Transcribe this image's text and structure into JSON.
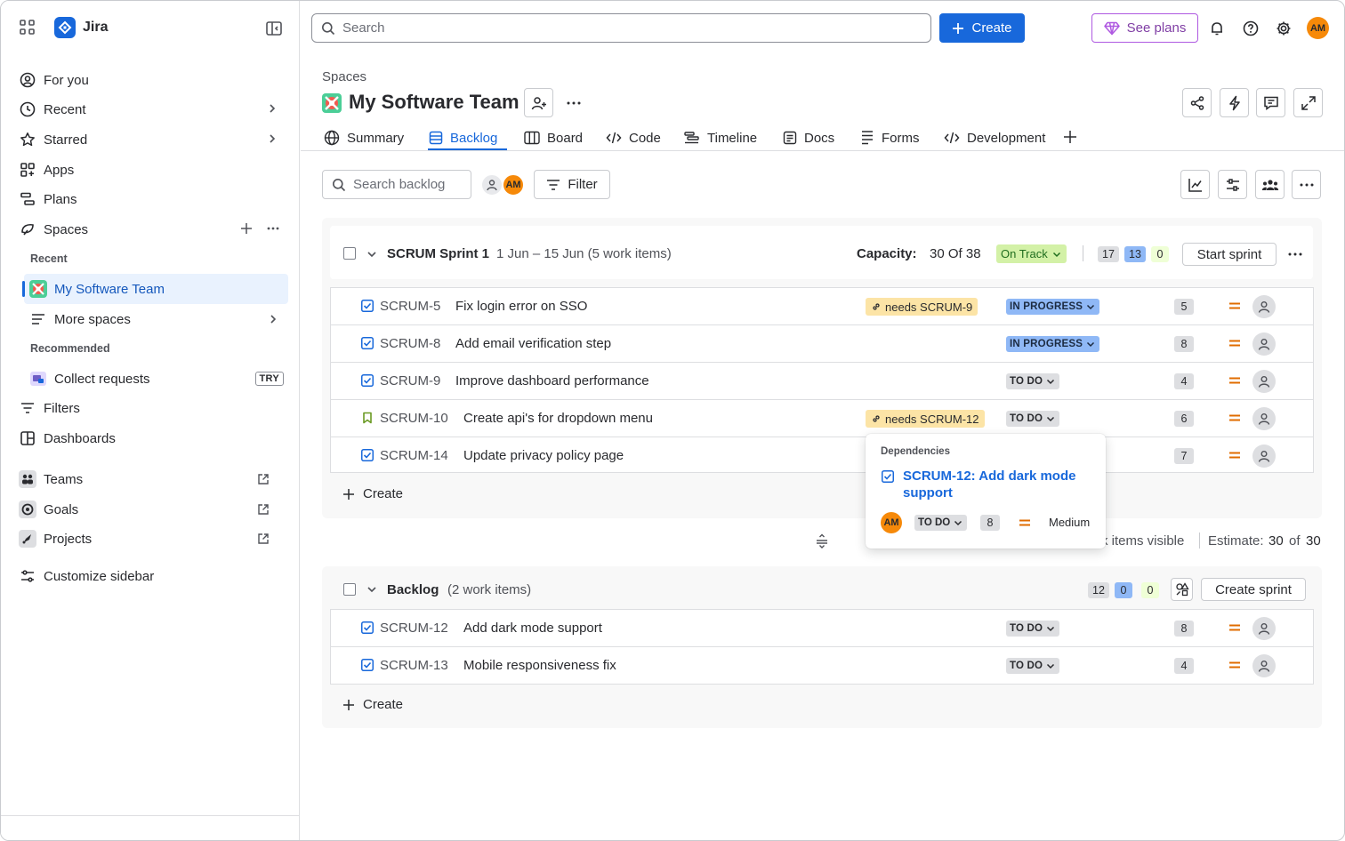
{
  "app": {
    "name": "Jira",
    "user_initials": "AM"
  },
  "topbar": {
    "search_placeholder": "Search",
    "create_label": "Create",
    "plans_label": "See plans"
  },
  "sidebar": {
    "items": [
      {
        "label": "For you"
      },
      {
        "label": "Recent"
      },
      {
        "label": "Starred"
      },
      {
        "label": "Apps"
      },
      {
        "label": "Plans"
      },
      {
        "label": "Spaces"
      }
    ],
    "recent_label": "Recent",
    "recent_space": "My Software Team",
    "more_spaces": "More spaces",
    "recommended_label": "Recommended",
    "collect_requests": "Collect requests",
    "try_badge": "TRY",
    "filters": "Filters",
    "dashboards": "Dashboards",
    "teams": "Teams",
    "goals": "Goals",
    "projects": "Projects",
    "customize": "Customize sidebar"
  },
  "page": {
    "breadcrumb": "Spaces",
    "title": "My Software Team",
    "tabs": [
      {
        "label": "Summary"
      },
      {
        "label": "Backlog"
      },
      {
        "label": "Board"
      },
      {
        "label": "Code"
      },
      {
        "label": "Timeline"
      },
      {
        "label": "Docs"
      },
      {
        "label": "Forms"
      },
      {
        "label": "Development"
      }
    ]
  },
  "toolbar": {
    "search_placeholder": "Search backlog",
    "filter_label": "Filter"
  },
  "sprint": {
    "name": "SCRUM Sprint 1",
    "dates": "1 Jun – 15 Jun (5 work items)",
    "capacity_label": "Capacity:",
    "capacity_value": "30 Of 38",
    "track_label": "On Track",
    "counts": [
      "17",
      "13",
      "0"
    ],
    "start_label": "Start sprint",
    "create_label": "Create",
    "items": [
      {
        "key": "SCRUM-5",
        "summary": "Fix login error on SSO",
        "dep": "needs SCRUM-9",
        "status": "IN PROGRESS",
        "points": "5"
      },
      {
        "key": "SCRUM-8",
        "summary": "Add email verification step",
        "dep": "",
        "status": "IN PROGRESS",
        "points": "8"
      },
      {
        "key": "SCRUM-9",
        "summary": "Improve dashboard performance",
        "dep": "",
        "status": "TO DO",
        "points": "4"
      },
      {
        "key": "SCRUM-10",
        "summary": "Create api's for dropdown menu",
        "dep": "needs SCRUM-12",
        "status": "TO DO",
        "points": "6"
      },
      {
        "key": "SCRUM-14",
        "summary": "Update privacy policy page",
        "dep": "",
        "status": "",
        "points": "7"
      }
    ],
    "footer_visible": "k items visible",
    "footer_estimate_label": "Estimate:",
    "footer_estimate_value": "30",
    "footer_of": "of",
    "footer_total": "30"
  },
  "popover": {
    "title": "Dependencies",
    "link": "SCRUM-12: Add dark mode support",
    "assignee": "AM",
    "status": "TO DO",
    "points": "8",
    "priority": "Medium"
  },
  "backlog": {
    "name": "Backlog",
    "count": "(2 work items)",
    "counts": [
      "12",
      "0",
      "0"
    ],
    "create_sprint_label": "Create sprint",
    "create_label": "Create",
    "items": [
      {
        "key": "SCRUM-12",
        "summary": "Add dark mode support",
        "status": "TO DO",
        "points": "8"
      },
      {
        "key": "SCRUM-13",
        "summary": "Mobile responsiveness fix",
        "status": "TO DO",
        "points": "4"
      }
    ]
  },
  "colors": {
    "brand": "#1868DB",
    "plans": "#803FA5",
    "avatar": "#F68909",
    "priority_medium": "#E06C00",
    "story": "#6A9A23"
  }
}
